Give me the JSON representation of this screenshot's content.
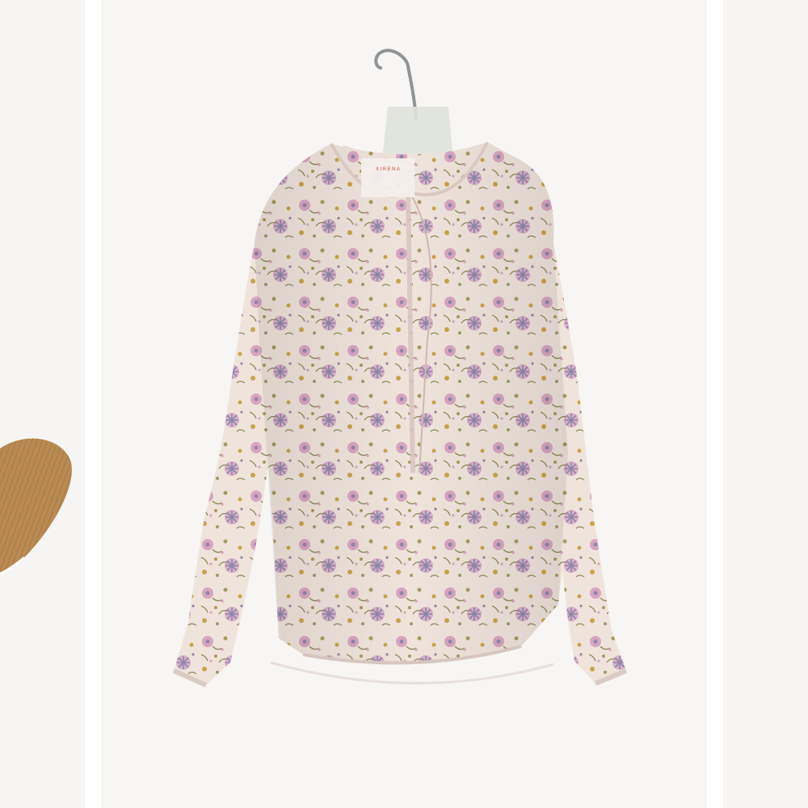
{
  "gallery": {
    "prev_item_icon": "garment-thumbnail",
    "product": {
      "brand_label": "XIRENA",
      "image_icon": "floral-blouse-on-hanger"
    },
    "zoom": {
      "icon": "magnifier-icon"
    }
  },
  "colors": {
    "background": "#ffffff",
    "slide_background": "#f6f5f4",
    "prev_item_fabric": "#b98a52",
    "blouse_base": "#efe4dc",
    "blouse_pink": "#d7a6c0",
    "blouse_slate": "#8e87a8",
    "blouse_olive": "#a89a5a",
    "brand_label_red": "#d84a3a"
  }
}
